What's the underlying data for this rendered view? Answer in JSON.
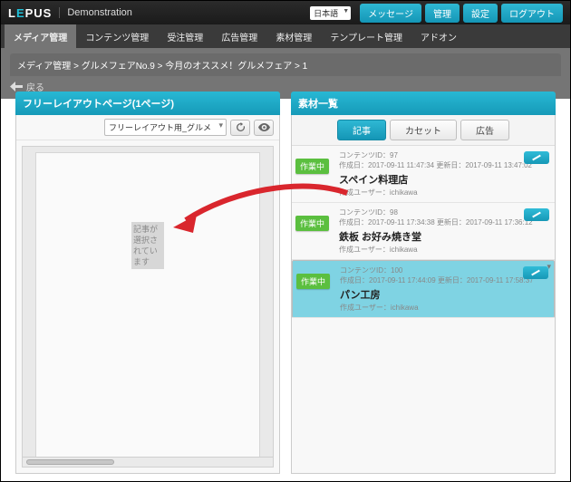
{
  "header": {
    "brand_prefix": "L",
    "brand_accent": "E",
    "brand_suffix": "PUS",
    "subtitle": "Demonstration",
    "lang": "日本語",
    "buttons": [
      "メッセージ",
      "管理",
      "設定",
      "ログアウト"
    ]
  },
  "tabs": [
    "メディア管理",
    "コンテンツ管理",
    "受注管理",
    "広告管理",
    "素材管理",
    "テンプレート管理",
    "アドオン"
  ],
  "active_tab_index": 0,
  "breadcrumb": "メディア管理 > グルメフェアNo.9 > 今月のオススメ！グルメフェア > 1",
  "back_label": "戻る",
  "left_panel": {
    "title": "フリーレイアウトページ(1ページ)",
    "dropdown": "フリーレイアウト用_グルメ",
    "drop_text": "記事が選択されています"
  },
  "right_panel": {
    "title": "素材一覧",
    "tabs": [
      "記事",
      "カセット",
      "広告"
    ],
    "active_tab_index": 0,
    "badge_label": "作業中",
    "items": [
      {
        "meta1": "コンテンツID：97",
        "meta2": "作成日：2017-09-11 11:47:34 更新日：2017-09-11 13:47:02",
        "title": "スペイン料理店",
        "author": "作成ユーザー：ichikawa",
        "selected": false
      },
      {
        "meta1": "コンテンツID：98",
        "meta2": "作成日：2017-09-11 17:34:38 更新日：2017-09-11 17:36:12",
        "title": "鉄板 お好み焼き堂",
        "author": "作成ユーザー：ichikawa",
        "selected": false
      },
      {
        "meta1": "コンテンツID：100",
        "meta2": "作成日：2017-09-11 17:44:09 更新日：2017-09-11 17:58:37",
        "title": "パン工房",
        "author": "作成ユーザー：ichikawa",
        "selected": true
      }
    ]
  }
}
